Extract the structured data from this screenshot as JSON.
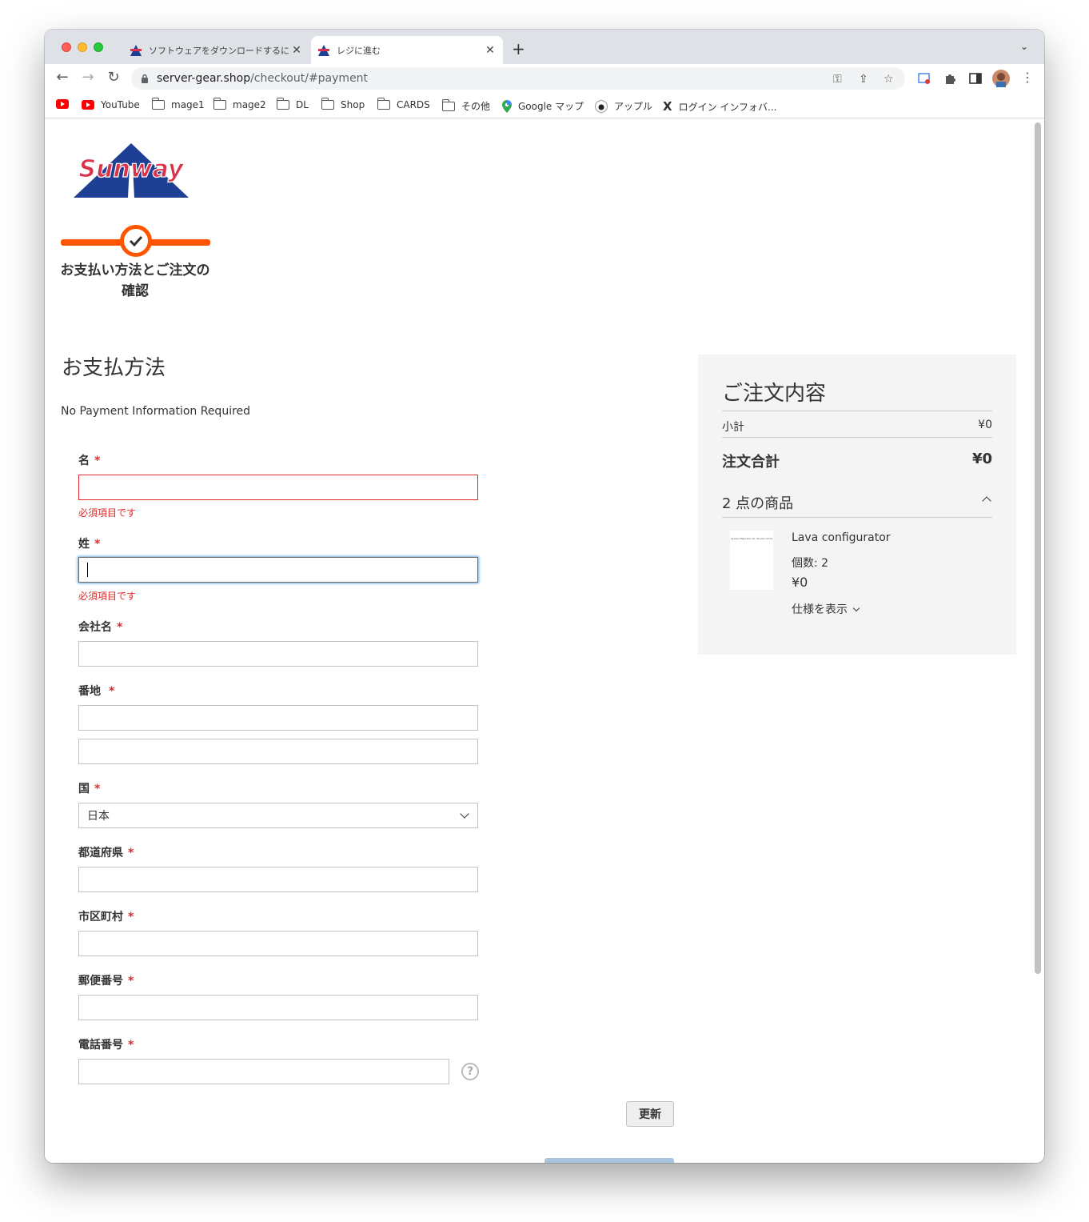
{
  "browser": {
    "tabs": [
      {
        "title": "ソフトウェアをダウンロードするに"
      },
      {
        "title": "レジに進む"
      }
    ],
    "url_host": "server-gear.shop",
    "url_path": "/checkout/#payment",
    "bookmarks": [
      {
        "label": ""
      },
      {
        "label": "YouTube"
      },
      {
        "label": "mage1"
      },
      {
        "label": "mage2"
      },
      {
        "label": "DL"
      },
      {
        "label": "Shop"
      },
      {
        "label": "CARDS"
      },
      {
        "label": "その他"
      },
      {
        "label": "Google マップ"
      },
      {
        "label": "アップル"
      },
      {
        "label": "ログイン インフォバ..."
      }
    ]
  },
  "logo": {
    "text": "Sunway"
  },
  "progress": {
    "step_label": "お支払い方法とご注文の確認"
  },
  "payment": {
    "title": "お支払方法",
    "no_payment": "No Payment Information Required"
  },
  "form": {
    "required_mark": "*",
    "error_text": "必須項目です",
    "first_name_label": "名",
    "last_name_label": "姓",
    "company_label": "会社名",
    "street_label": "番地",
    "country_label": "国",
    "country_value": "日本",
    "region_label": "都道府県",
    "city_label": "市区町村",
    "postcode_label": "郵便番号",
    "phone_label": "電話番号",
    "help_symbol": "?",
    "update_button": "更新"
  },
  "summary": {
    "title": "ご注文内容",
    "subtotal_label": "小計",
    "subtotal_value": "¥0",
    "grand_total_label": "注文合計",
    "grand_total_value": "¥0",
    "items_count": "2 点の商品",
    "item": {
      "name": "Lava configurator",
      "qty": "個数: 2",
      "price": "¥0",
      "spec_toggle": "仕様を表示",
      "thumb_text": "LavaConfigurator for Ubuntu 20.04"
    }
  },
  "colors": {
    "accent": "#ff5501",
    "error": "#e02b27",
    "summary_bg": "#f4f4f4"
  }
}
